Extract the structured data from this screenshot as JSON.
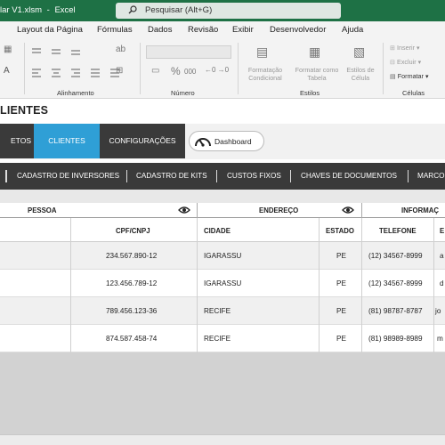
{
  "window": {
    "filename": "lar V1.xlsm",
    "app": "Excel",
    "separator": "-"
  },
  "search": {
    "placeholder": "Pesquisar (Alt+G)"
  },
  "menu": [
    "Layout da Página",
    "Fórmulas",
    "Dados",
    "Revisão",
    "Exibir",
    "Desenvolvedor",
    "Ajuda"
  ],
  "ribbon": {
    "groups": {
      "alinhamento": "Alinhamento",
      "numero": "Número",
      "estilos": "Estilos",
      "celulas": "Células"
    },
    "percent": "%",
    "comma": "000",
    "styles": {
      "conditional": "Formatação\nCondicional",
      "table": "Formatar como\nTabela",
      "cell": "Estilos de\nCélula"
    },
    "cells": {
      "insert": "Inserir",
      "delete": "Excluir",
      "format": "Formatar"
    }
  },
  "sheet": {
    "title": "LIENTES",
    "tabs": {
      "produtos": "ETOS",
      "clientes": "CLIENTES",
      "configuracoes": "CONFIGURAÇÕES",
      "dashboard": "Dashboard"
    },
    "subnav": [
      "CADASTRO DE INVERSORES",
      "CADASTRO DE KITS",
      "CUSTOS FIXOS",
      "CHAVES DE DOCUMENTOS",
      "MARCO"
    ],
    "sections": {
      "pessoa": "PESSOA",
      "endereco": "ENDEREÇO",
      "informacoes": "INFORMAÇ"
    },
    "columns": {
      "cpf": "CPF/CNPJ",
      "cidade": "CIDADE",
      "estado": "ESTADO",
      "telefone": "TELEFONE",
      "email": "E"
    },
    "rows": [
      {
        "cpf": "234.567.890-12",
        "cidade": "IGARASSU",
        "estado": "PE",
        "telefone": "(12) 34567-8999",
        "email": "a"
      },
      {
        "cpf": "123.456.789-12",
        "cidade": "IGARASSU",
        "estado": "PE",
        "telefone": "(12) 34567-8999",
        "email": "d"
      },
      {
        "cpf": "789.456.123-36",
        "cidade": "RECIFE",
        "estado": "PE",
        "telefone": "(81) 98787-8787",
        "email": "jo"
      },
      {
        "cpf": "874.587.458-74",
        "cidade": "RECIFE",
        "estado": "PE",
        "telefone": "(81) 98989-8989",
        "email": "m"
      }
    ]
  },
  "colors": {
    "excel_green": "#1e7145",
    "tab_active": "#2f9fd6",
    "nav_dark": "#3a3a3a",
    "row_alt": "#f0f0f0"
  }
}
